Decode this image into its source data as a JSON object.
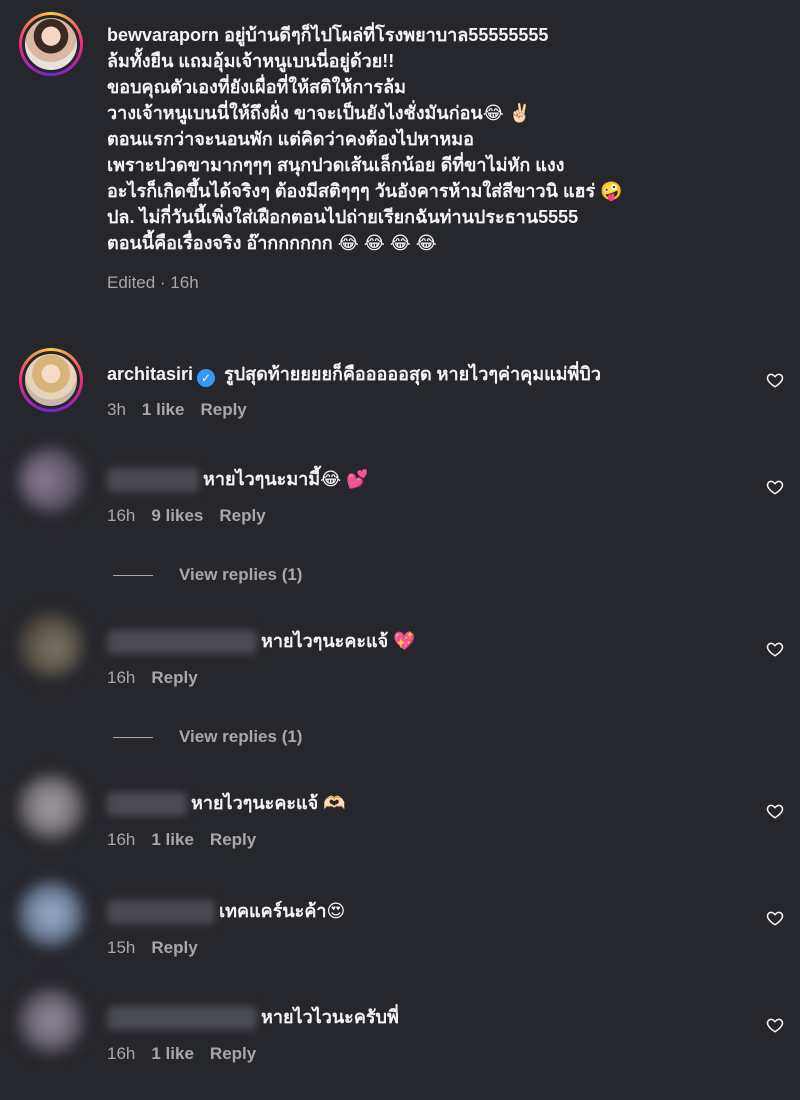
{
  "post": {
    "author": "bewvaraporn",
    "lines": [
      "อยู่บ้านดีๆก็ไปโผล่ที่โรงพยาบาล55555555",
      "ล้มทั้งยืน แถมอุ้มเจ้าหนูเบนนี่อยู่ด้วย!!",
      "ขอบคุณตัวเองที่ยังเผื่อที่ให้สติให้การล้ม",
      "วางเจ้าหนูเบนนี่ให้ถึงฝั่ง ขาจะเป็นยังไงชั่งมันก่อน😂 ✌🏻",
      "ตอนแรกว่าจะนอนพัก แต่คิดว่าคงต้องไปหาหมอ",
      "เพราะปวดขามากๆๆๆ สนุกปวดเส้นเล็กน้อย ดีที่ขาไม่หัก แงง",
      "อะไรก็เกิดขึ้นได้จริงๆ ต้องมีสติๆๆๆ วันอังคารห้ามใส่สีขาวนิ แฮร่ 🤪",
      "ปล. ไม่กี่วันนี้เพิ่งใส่เฝือกตอนไปถ่ายเรียกฉันท่านประธาน5555",
      "ตอนนี้คือเรื่องจริง อ๊ากกกกกก 😂 😂 😂 😂"
    ],
    "meta": "Edited · 16h"
  },
  "comments": [
    {
      "author": "architasiri",
      "verified": "✓",
      "text": "รูปสุดท้ายยยยก็คือออออสุด หายไวๆค่าคุมแม่พี่บิว",
      "time": "3h",
      "likes": "1 like",
      "reply": "Reply"
    },
    {
      "text": "หายไวๆนะมามี้😂 💕",
      "time": "16h",
      "likes": "9 likes",
      "reply": "Reply",
      "view_replies": "View replies (1)"
    },
    {
      "text": "หายไวๆนะคะแจ้ 💖",
      "time": "16h",
      "reply": "Reply",
      "view_replies": "View replies (1)"
    },
    {
      "text": "หายไวๆนะคะแจ้ 🫶🏻",
      "time": "16h",
      "likes": "1 like",
      "reply": "Reply"
    },
    {
      "text": "เทคแคร์นะค้า😍",
      "time": "15h",
      "reply": "Reply"
    },
    {
      "text": "หายไวไวนะครับพี่",
      "time": "16h",
      "likes": "1 like",
      "reply": "Reply"
    }
  ],
  "icons": {
    "like": "heart-outline-icon"
  },
  "colors": {
    "background": "#26272c",
    "muted": "#a8a8a8",
    "verified": "#3897f0"
  }
}
